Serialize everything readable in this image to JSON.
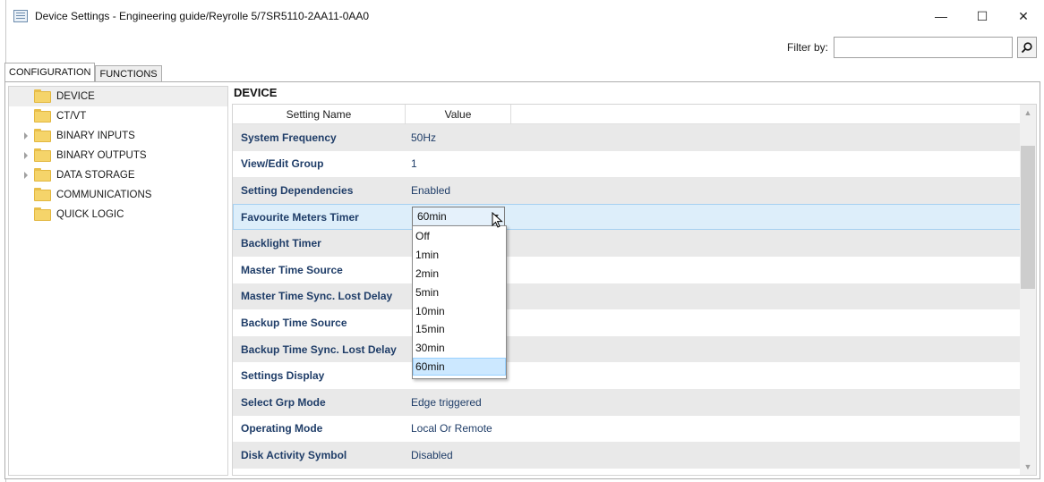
{
  "window": {
    "title": "Device Settings - Engineering guide/Reyrolle 5/7SR5110-2AA11-0AA0",
    "controls": {
      "minimize": "—",
      "maximize": "☐",
      "close": "✕"
    }
  },
  "filter": {
    "label": "Filter by:",
    "value": "",
    "button_icon": "search-icon"
  },
  "tabs": [
    {
      "label": "CONFIGURATION",
      "active": true
    },
    {
      "label": "FUNCTIONS",
      "active": false
    }
  ],
  "tree": {
    "items": [
      {
        "label": "DEVICE",
        "expandable": false,
        "selected": true
      },
      {
        "label": "CT/VT",
        "expandable": false,
        "selected": false
      },
      {
        "label": "BINARY INPUTS",
        "expandable": true,
        "selected": false
      },
      {
        "label": "BINARY OUTPUTS",
        "expandable": true,
        "selected": false
      },
      {
        "label": "DATA STORAGE",
        "expandable": true,
        "selected": false
      },
      {
        "label": "COMMUNICATIONS",
        "expandable": false,
        "selected": false
      },
      {
        "label": "QUICK LOGIC",
        "expandable": false,
        "selected": false
      }
    ]
  },
  "main": {
    "section_title": "DEVICE",
    "columns": {
      "name": "Setting Name",
      "value": "Value"
    },
    "rows": [
      {
        "name": "System Frequency",
        "value": "50Hz"
      },
      {
        "name": "View/Edit Group",
        "value": "1"
      },
      {
        "name": "Setting Dependencies",
        "value": "Enabled"
      },
      {
        "name": "Favourite Meters Timer",
        "value": ""
      },
      {
        "name": "Backlight Timer",
        "value": ""
      },
      {
        "name": "Master Time Source",
        "value": ""
      },
      {
        "name": "Master Time Sync. Lost Delay",
        "value": ""
      },
      {
        "name": "Backup Time Source",
        "value": ""
      },
      {
        "name": "Backup Time Sync. Lost Delay",
        "value": ""
      },
      {
        "name": "Settings Display",
        "value": ""
      },
      {
        "name": "Select Grp Mode",
        "value": "Edge triggered"
      },
      {
        "name": "Operating Mode",
        "value": "Local Or Remote"
      },
      {
        "name": "Disk Activity Symbol",
        "value": "Disabled"
      }
    ],
    "combo": {
      "selected": "60min",
      "options": [
        "Off",
        "1min",
        "2min",
        "5min",
        "10min",
        "15min",
        "30min",
        "60min"
      ]
    }
  }
}
